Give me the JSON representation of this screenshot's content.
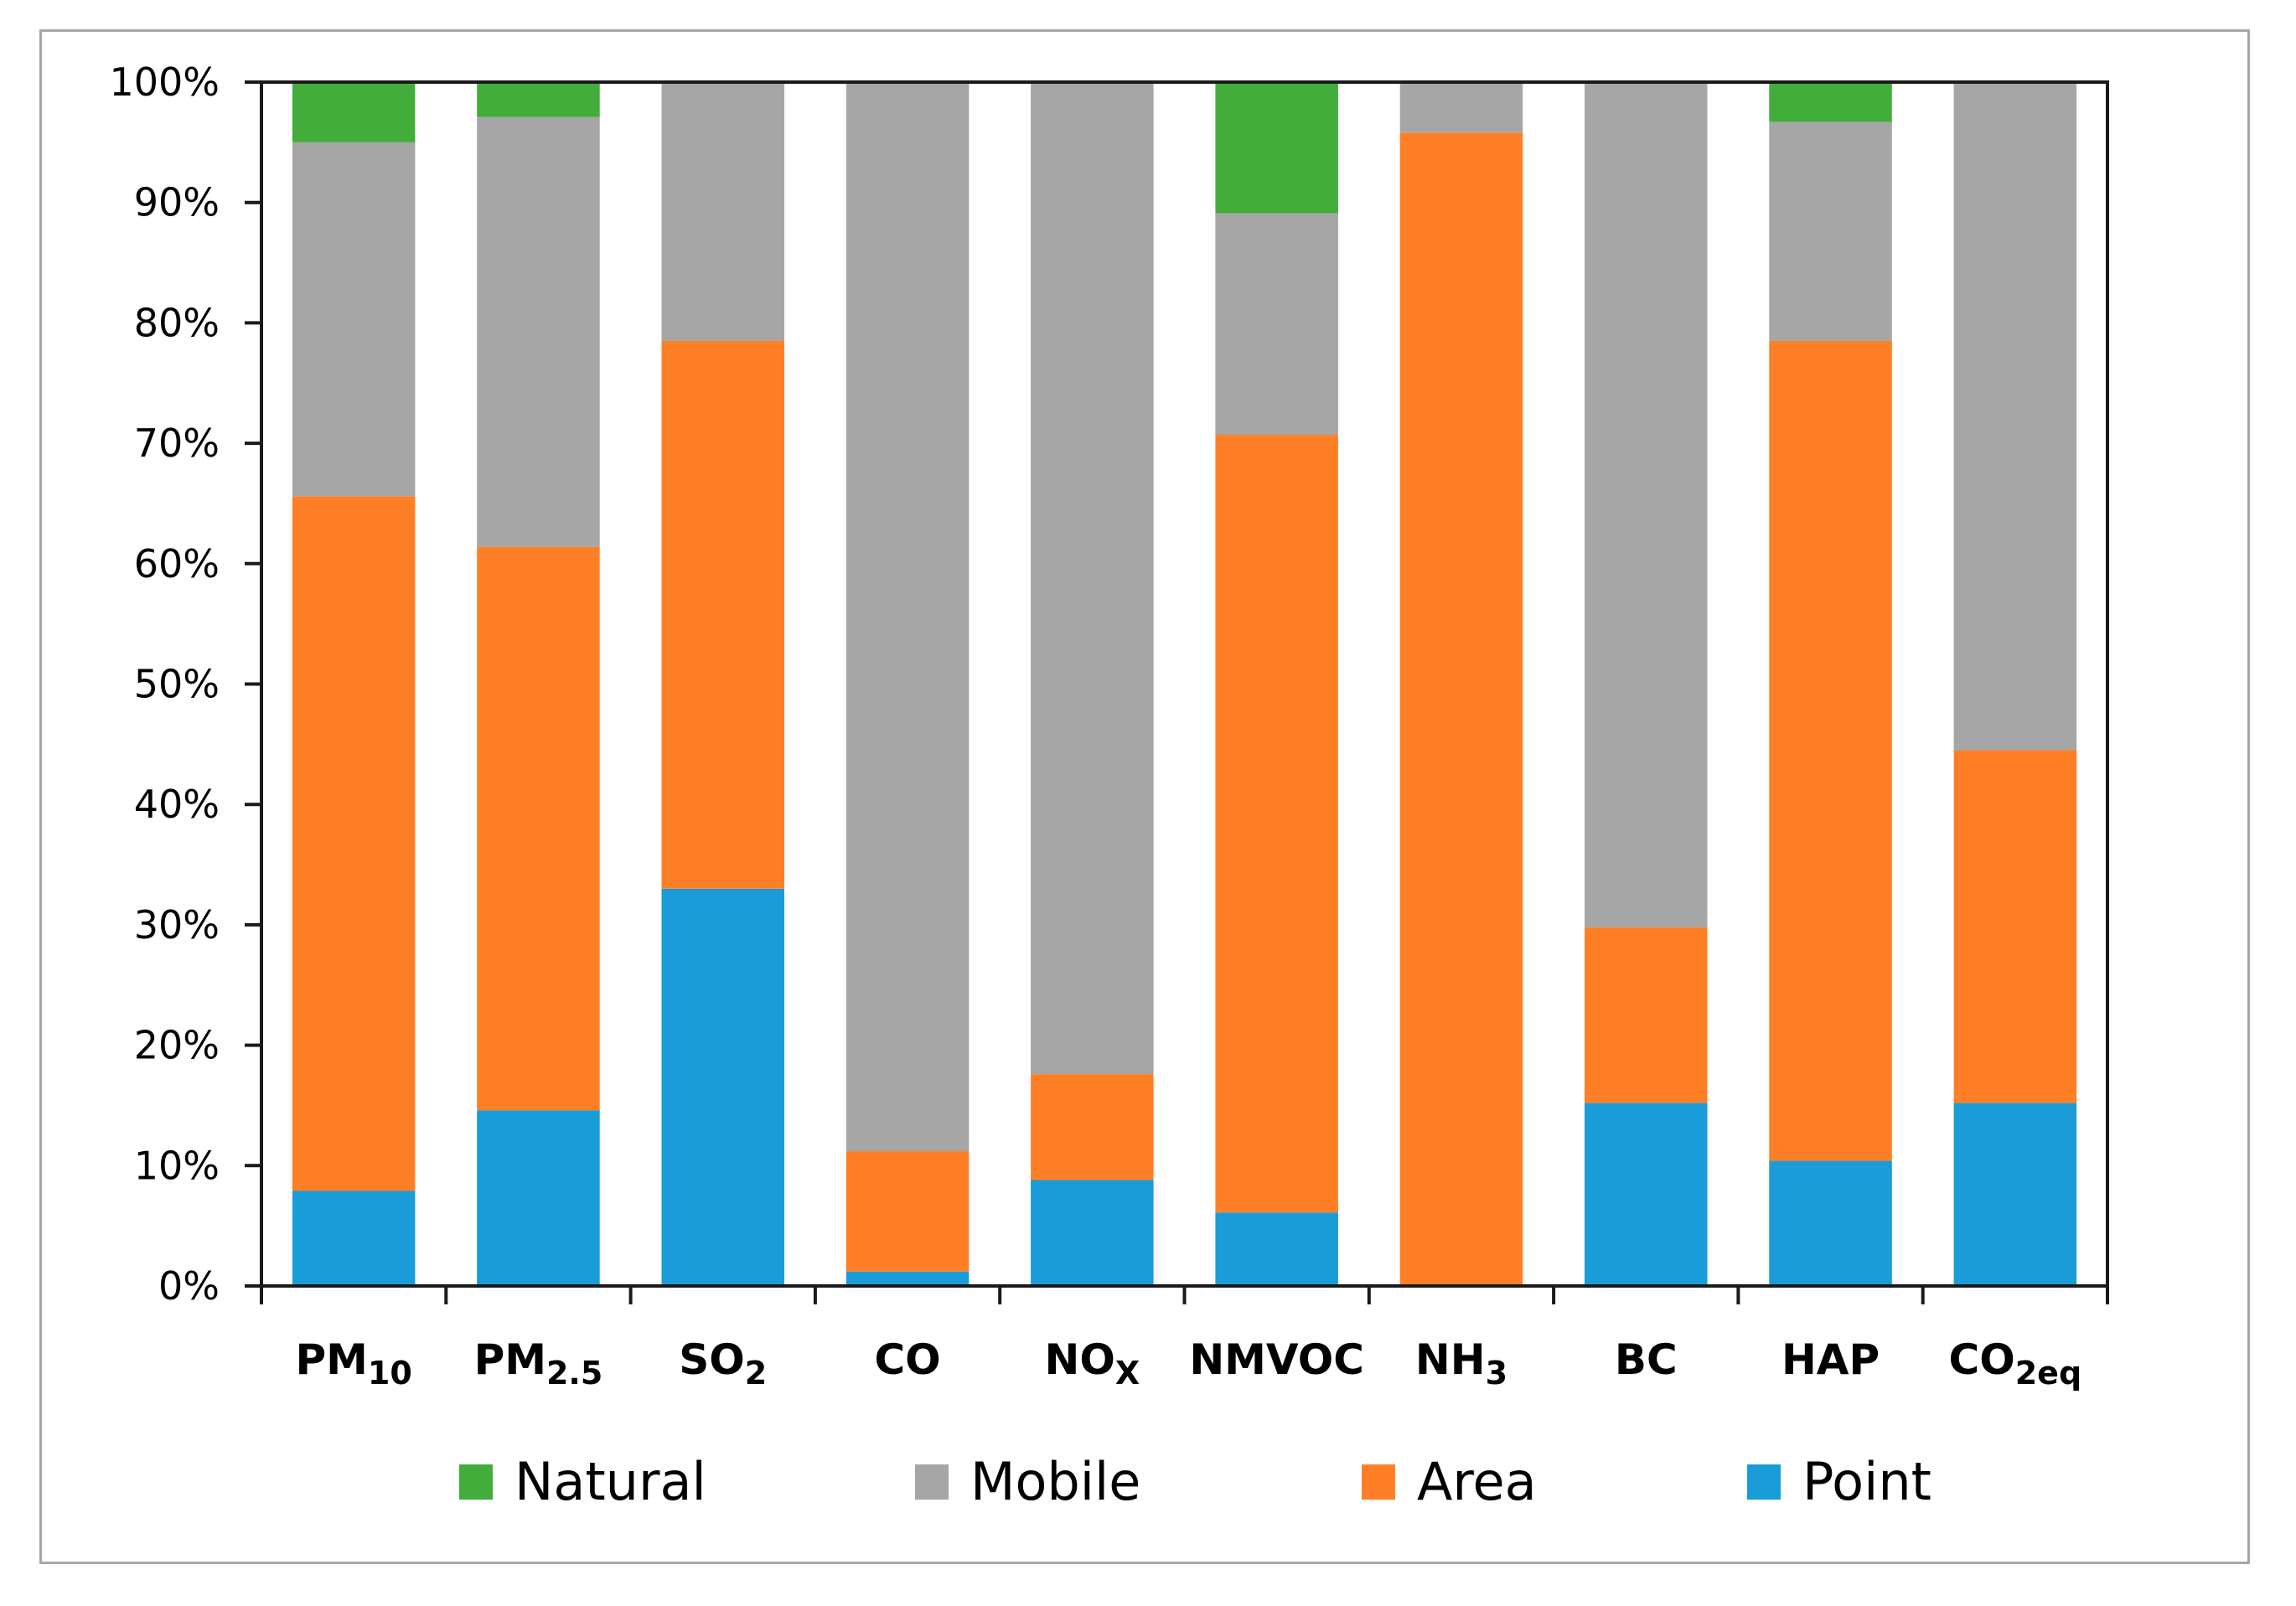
{
  "chart_data": {
    "type": "bar",
    "stacked": true,
    "percent": true,
    "title": "",
    "xlabel": "",
    "ylabel": "",
    "ylim": [
      0,
      100
    ],
    "yticks": [
      "0%",
      "10%",
      "20%",
      "30%",
      "40%",
      "50%",
      "60%",
      "70%",
      "80%",
      "90%",
      "100%"
    ],
    "grid": false,
    "legend_position": "bottom",
    "categories": [
      {
        "main": "PM",
        "sub": "10"
      },
      {
        "main": "PM",
        "sub": "2.5"
      },
      {
        "main": "SO",
        "sub": "2"
      },
      {
        "main": "CO",
        "sub": ""
      },
      {
        "main": "NO",
        "sub": "X"
      },
      {
        "main": "NMVOC",
        "sub": ""
      },
      {
        "main": "NH",
        "sub": "3"
      },
      {
        "main": "BC",
        "sub": ""
      },
      {
        "main": "HAP",
        "sub": ""
      },
      {
        "main": "CO",
        "sub": "2eq"
      }
    ],
    "series": [
      {
        "name": "Point",
        "color": "#1a9cd8",
        "values": [
          7.9,
          14.6,
          33.0,
          1.2,
          8.8,
          6.1,
          0.0,
          15.2,
          10.4,
          15.2
        ]
      },
      {
        "name": "Area",
        "color": "#ff7f27",
        "values": [
          57.7,
          46.8,
          45.5,
          10.0,
          8.8,
          64.6,
          95.8,
          14.6,
          68.1,
          29.3
        ]
      },
      {
        "name": "Mobile",
        "color": "#a6a6a6",
        "values": [
          29.4,
          35.7,
          21.5,
          88.8,
          82.4,
          18.4,
          4.2,
          70.2,
          18.2,
          55.5
        ]
      },
      {
        "name": "Natural",
        "color": "#43ad3b",
        "values": [
          5.0,
          2.9,
          0.0,
          0.0,
          0.0,
          10.9,
          0.0,
          0.0,
          3.3,
          0.0
        ]
      }
    ],
    "legend_order": [
      "Natural",
      "Mobile",
      "Area",
      "Point"
    ]
  }
}
